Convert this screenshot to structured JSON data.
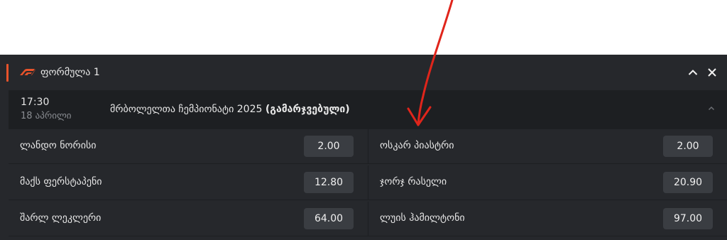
{
  "section": {
    "title": "ფორმულა 1",
    "logo_icon": "f1-logo-icon",
    "accent_color": "#e8532b",
    "collapse_icon": "chevron-up-icon",
    "close_icon": "close-icon"
  },
  "event": {
    "time": "17:30",
    "date": "18 აპრილი",
    "title": "მრბოლელთა ჩემპიონატი 2025",
    "title_suffix": "(გამარჯვებული)",
    "toggle_icon": "chevron-up-icon"
  },
  "odds": [
    {
      "name": "ლანდო ნორისი",
      "value": "2.00"
    },
    {
      "name": "ოსკარ პიასტრი",
      "value": "2.00"
    },
    {
      "name": "მაქს ფერსტაპენი",
      "value": "12.80"
    },
    {
      "name": "ჯორჯ რასელი",
      "value": "20.90"
    },
    {
      "name": "შარლ ლეკლერი",
      "value": "64.00"
    },
    {
      "name": "ლუის ჰამილტონი",
      "value": "97.00"
    }
  ],
  "annotation": {
    "arrow_color": "#e0251b"
  }
}
